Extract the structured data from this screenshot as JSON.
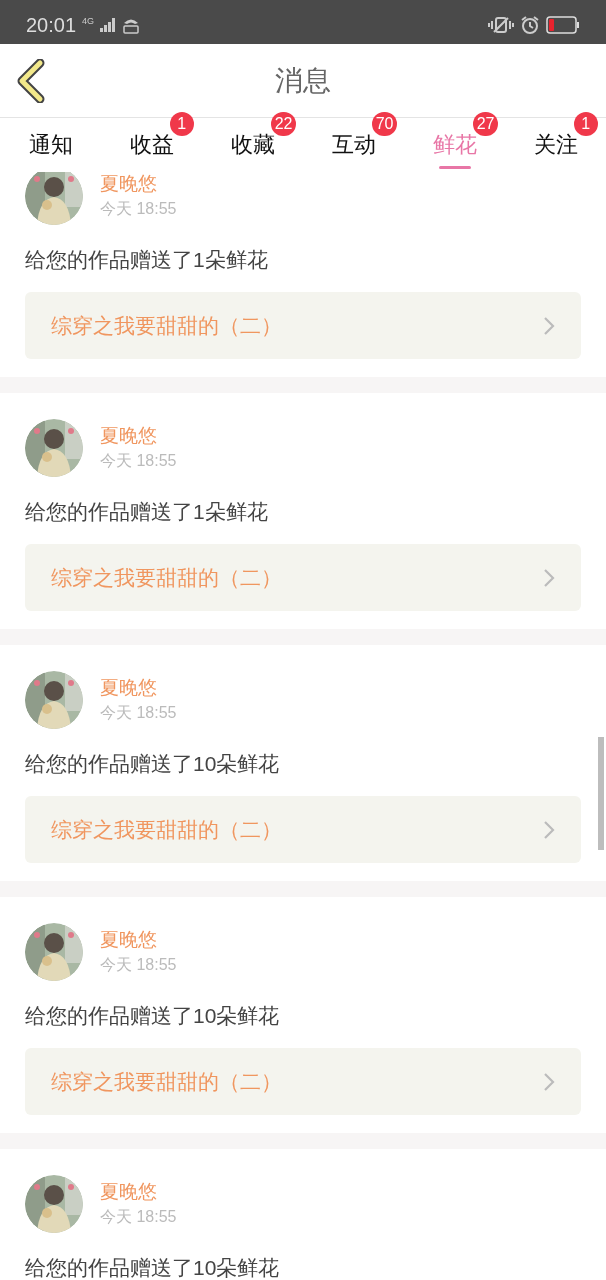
{
  "status_bar": {
    "time": "20:01",
    "network": "4G"
  },
  "header": {
    "title": "消息"
  },
  "tabs": [
    {
      "label": "通知",
      "selected": false
    },
    {
      "label": "收益",
      "badge": "1",
      "selected": false
    },
    {
      "label": "收藏",
      "badge": "22",
      "selected": false
    },
    {
      "label": "互动",
      "badge": "70",
      "selected": false
    },
    {
      "label": "鲜花",
      "badge": "27",
      "selected": true
    },
    {
      "label": "关注",
      "badge": "1",
      "selected": false
    }
  ],
  "messages": [
    {
      "name": "夏晚悠",
      "time": "今天 18:55",
      "text": "给您的作品赠送了1朵鲜花",
      "book": "综穿之我要甜甜的（二）"
    },
    {
      "name": "夏晚悠",
      "time": "今天 18:55",
      "text": "给您的作品赠送了1朵鲜花",
      "book": "综穿之我要甜甜的（二）"
    },
    {
      "name": "夏晚悠",
      "time": "今天 18:55",
      "text": "给您的作品赠送了10朵鲜花",
      "book": "综穿之我要甜甜的（二）"
    },
    {
      "name": "夏晚悠",
      "time": "今天 18:55",
      "text": "给您的作品赠送了10朵鲜花",
      "book": "综穿之我要甜甜的（二）"
    },
    {
      "name": "夏晚悠",
      "time": "今天 18:55",
      "text": "给您的作品赠送了10朵鲜花"
    }
  ]
}
